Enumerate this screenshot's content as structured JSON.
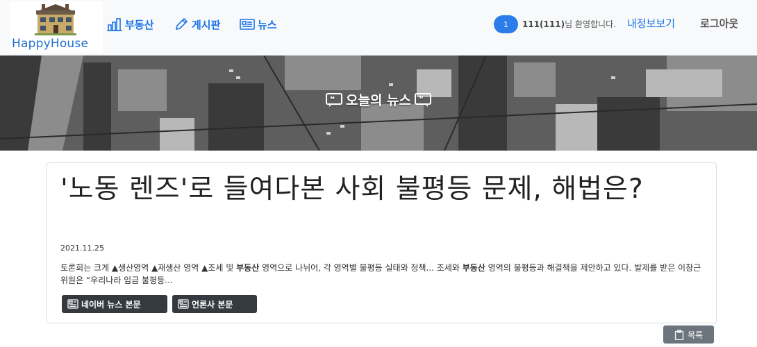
{
  "logo": {
    "text": "HappyHouse"
  },
  "nav": {
    "items": [
      {
        "label": "부동산",
        "icon": "building-icon"
      },
      {
        "label": "게시판",
        "icon": "pencil-icon"
      },
      {
        "label": "뉴스",
        "icon": "newspaper-icon"
      }
    ]
  },
  "user": {
    "badge": "1",
    "name": "111(111)",
    "welcome_suffix": "님 환영합니다.",
    "mypage_label": "내정보보기",
    "logout_label": "로그아웃"
  },
  "hero": {
    "title": "오늘의 뉴스"
  },
  "article": {
    "title": "'노동 렌즈'로 들여다본 사회 불평등 문제, 해법은?",
    "date": "2021.11.25",
    "body_parts": [
      "토론회는 크게 ▲생산영역 ▲재생산 영역 ▲조세 및 ",
      "부동산",
      " 영역으로 나뉘어, 각 영역별 불평등 실태와 정책... 조세와 ",
      "부동산",
      " 영역의 불평등과 해결책을 제안하고 있다. 발제를 받은 이창근 위원은 “우리나라 임금 불평등..."
    ],
    "naver_button": "네이버 뉴스 본문",
    "press_button": "언론사 본문"
  },
  "list_button": "목록",
  "colors": {
    "accent": "#1a73e8",
    "badge": "#2b7de9",
    "dark_button": "#343a40",
    "gray_button": "#6c757d"
  }
}
